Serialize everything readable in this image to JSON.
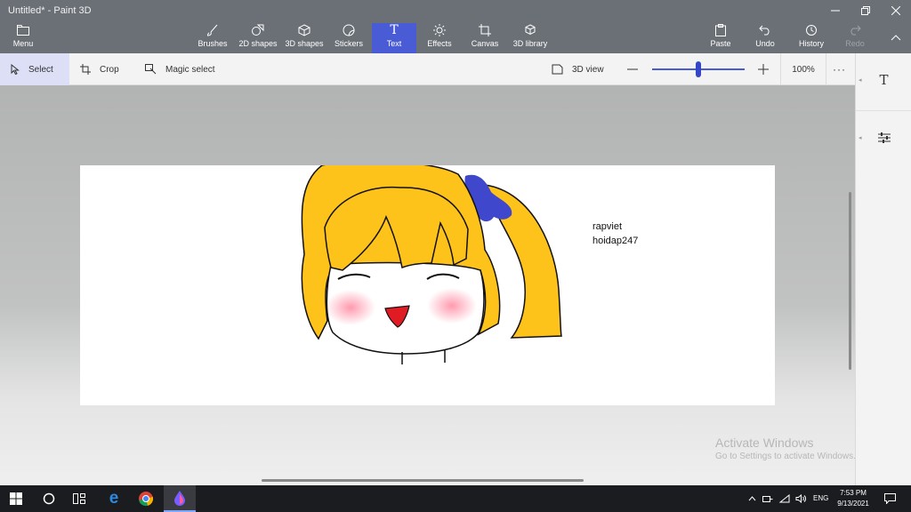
{
  "window": {
    "title": "Untitled* - Paint 3D"
  },
  "ribbon": {
    "menu": "Menu",
    "items": [
      "Brushes",
      "2D shapes",
      "3D shapes",
      "Stickers",
      "Text",
      "Effects",
      "Canvas",
      "3D library"
    ],
    "right": {
      "paste": "Paste",
      "undo": "Undo",
      "history": "History",
      "redo": "Redo"
    }
  },
  "toolbar": {
    "select": "Select",
    "crop": "Crop",
    "magic_select": "Magic select",
    "view3d": "3D view",
    "zoom": "100%",
    "zoom_level": 0.5
  },
  "canvas": {
    "text_line1": "rapviet",
    "text_line2": "hoidap247"
  },
  "watermark": {
    "title": "Activate Windows",
    "subtitle": "Go to Settings to activate Windows."
  },
  "taskbar": {
    "lang": "ENG",
    "time": "7:53 PM",
    "date": "9/13/2021"
  },
  "colors": {
    "ribbon": "#6b6f76",
    "accent": "#4a5bd6",
    "hair": "#fec31b",
    "bow": "#3f47cc",
    "mouth": "#e01b24"
  }
}
